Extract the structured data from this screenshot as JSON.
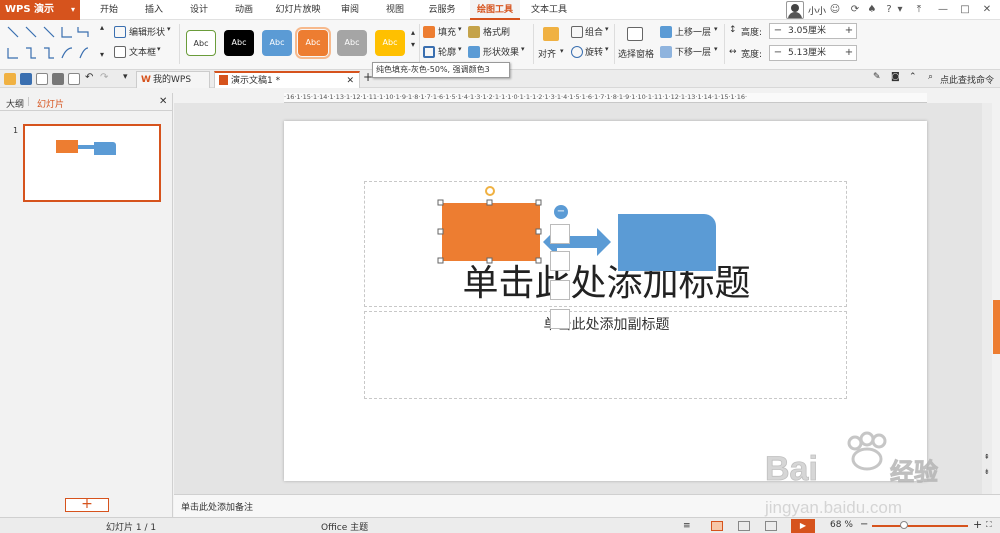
{
  "app": {
    "name": "WPS 演示"
  },
  "menu": [
    "开始",
    "插入",
    "设计",
    "动画",
    "幻灯片放映",
    "审阅",
    "视图",
    "云服务",
    "绘图工具",
    "文本工具"
  ],
  "user": {
    "name": "小小"
  },
  "ribbon": {
    "edit_shape": "编辑形状",
    "textbox": "文本框",
    "style_sample": "Abc",
    "style_colors": [
      "#ffffff",
      "#000000",
      "#5b9bd5",
      "#ed7d31",
      "#a5a5a5",
      "#ffc000"
    ],
    "fill": "填充",
    "format_painter": "格式刷",
    "outline": "轮廓",
    "shape_effects": "形状效果",
    "align": "对齐",
    "group": "组合",
    "rotate": "旋转",
    "selection_pane": "选择窗格",
    "bring_forward": "上移一层",
    "send_backward": "下移一层",
    "height_label": "高度:",
    "height_value": "3.05厘米",
    "width_label": "宽度:",
    "width_value": "5.13厘米",
    "find_command": "点此查找命令"
  },
  "tooltip": "纯色填充-灰色-50%, 强调颜色3",
  "tabs": {
    "my_wps": "我的WPS",
    "document": "演示文稿1 *"
  },
  "panel": {
    "outline_tab": "大纲",
    "slides_tab": "幻灯片",
    "slide_number": "1"
  },
  "ruler_text": "·16·1·15·1·14·1·13·1·12·1·11·1·10·1·9·1·8·1·7·1·6·1·5·1·4·1·3·1·2·1·1·1·0·1·1·1·2·1·3·1·4·1·5·1·6·1·7·1·8·1·9·1·10·1·11·1·12·1·13·1·14·1·15·1·16·",
  "slide": {
    "title_placeholder": "单击此处添加标题",
    "subtitle_placeholder": "单击此处添加副标题"
  },
  "notes_placeholder": "单击此处添加备注",
  "status": {
    "slide_count": "幻灯片 1 / 1",
    "theme": "Office 主题",
    "zoom": "68 %"
  },
  "colors": {
    "accent": "#d6531d",
    "orange_shape": "#ed7d31",
    "blue_shape": "#5b9bd5"
  }
}
